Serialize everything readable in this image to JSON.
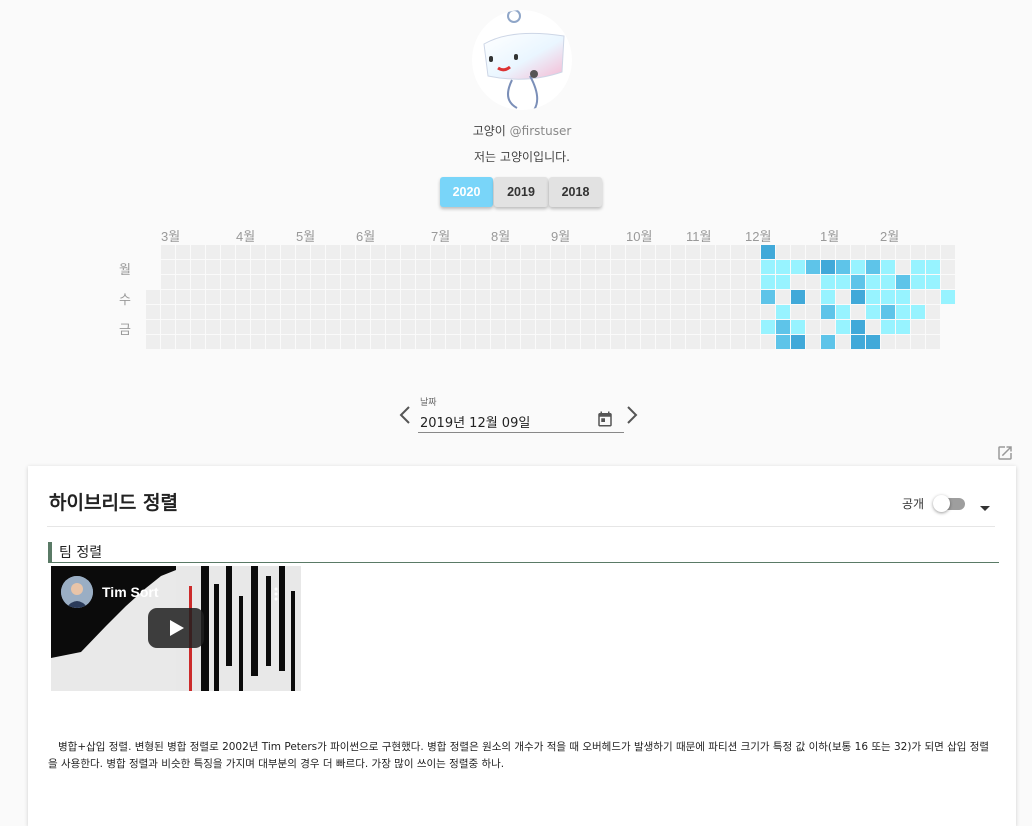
{
  "profile": {
    "name": "고양이",
    "handle": "@firstuser",
    "bio": "저는 고양이입니다."
  },
  "years": [
    "2020",
    "2019",
    "2018"
  ],
  "active_year": "2020",
  "heatmap": {
    "months": [
      "3월",
      "4월",
      "5월",
      "6월",
      "7월",
      "8월",
      "9월",
      "10월",
      "11월",
      "12월",
      "1월",
      "2월"
    ],
    "day_labels": [
      "월",
      "수",
      "금"
    ],
    "colors": {
      "empty": "#eeeeee",
      "level1": "#97f3ff",
      "level2": "#5ec4e9",
      "level3": "#41a9d9"
    },
    "active_cells": [
      [
        41,
        0,
        3
      ],
      [
        42,
        1,
        1
      ],
      [
        43,
        1,
        1
      ],
      [
        46,
        1,
        2
      ],
      [
        47,
        1,
        3
      ],
      [
        48,
        1,
        2
      ],
      [
        49,
        1,
        1
      ],
      [
        41,
        1,
        1
      ],
      [
        44,
        1,
        2
      ],
      [
        45,
        1,
        3
      ],
      [
        46,
        1,
        2
      ],
      [
        47,
        1,
        1
      ],
      [
        48,
        1,
        2
      ],
      [
        49,
        1,
        1
      ],
      [
        51,
        1,
        1
      ],
      [
        52,
        1,
        1
      ],
      [
        41,
        2,
        1
      ],
      [
        42,
        2,
        1
      ],
      [
        45,
        2,
        1
      ],
      [
        46,
        2,
        1
      ],
      [
        47,
        2,
        2
      ],
      [
        48,
        2,
        1
      ],
      [
        49,
        2,
        1
      ],
      [
        50,
        2,
        2
      ],
      [
        51,
        2,
        1
      ],
      [
        52,
        2,
        1
      ],
      [
        41,
        3,
        2
      ],
      [
        43,
        3,
        3
      ],
      [
        45,
        3,
        1
      ],
      [
        47,
        3,
        3
      ],
      [
        48,
        3,
        1
      ],
      [
        49,
        3,
        1
      ],
      [
        50,
        3,
        1
      ],
      [
        53,
        3,
        1
      ],
      [
        42,
        4,
        1
      ],
      [
        45,
        4,
        2
      ],
      [
        46,
        4,
        1
      ],
      [
        48,
        4,
        1
      ],
      [
        49,
        4,
        2
      ],
      [
        50,
        4,
        1
      ],
      [
        51,
        4,
        1
      ],
      [
        41,
        5,
        1
      ],
      [
        42,
        5,
        2
      ],
      [
        43,
        5,
        1
      ],
      [
        46,
        5,
        1
      ],
      [
        47,
        5,
        3
      ],
      [
        49,
        5,
        1
      ],
      [
        50,
        5,
        1
      ],
      [
        42,
        6,
        2
      ],
      [
        43,
        6,
        3
      ],
      [
        45,
        6,
        2
      ],
      [
        47,
        6,
        3
      ],
      [
        48,
        6,
        3
      ]
    ]
  },
  "date_picker": {
    "label": "날짜",
    "value": "2019년 12월 09일"
  },
  "post": {
    "title": "하이브리드 정렬",
    "public_label": "공개",
    "section_heading": "팀 정렬",
    "video_title": "Tim Sort",
    "description": "병합+삽입 정렬. 변형된 병합 정렬로 2002년 Tim Peters가 파이썬으로 구현했다. 병합 정렬은 원소의 개수가 적을 때 오버헤드가 발생하기 때문에 파티션 크기가 특정 값 이하(보통 16 또는 32)가 되면 삽입 정렬을 사용한다. 병합 정렬과 비슷한 특징을 가지며 대부분의 경우 더 빠르다. 가장 많이 쓰이는 정렬중 하나."
  }
}
